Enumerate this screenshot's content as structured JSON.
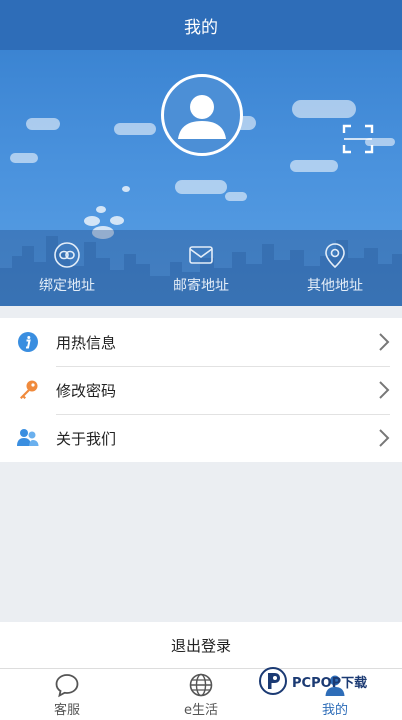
{
  "header": {
    "title": "我的"
  },
  "profile": {
    "avatar_icon": "user-avatar-icon",
    "scan_icon": "scan-icon"
  },
  "address_links": [
    {
      "label": "绑定地址",
      "icon": "link-icon"
    },
    {
      "label": "邮寄地址",
      "icon": "mail-icon"
    },
    {
      "label": "其他地址",
      "icon": "location-pin-icon"
    }
  ],
  "menu": [
    {
      "label": "用热信息",
      "icon": "info-icon",
      "icon_color": "#3a8ee0"
    },
    {
      "label": "修改密码",
      "icon": "key-icon",
      "icon_color": "#f08a3c"
    },
    {
      "label": "关于我们",
      "icon": "people-icon",
      "icon_color": "#3a8ee0"
    }
  ],
  "logout_label": "退出登录",
  "tabs": [
    {
      "label": "客服",
      "icon": "chat-bubble-icon",
      "active": false
    },
    {
      "label": "e生活",
      "icon": "globe-icon",
      "active": false
    },
    {
      "label": "我的",
      "icon": "user-icon",
      "active": true
    }
  ],
  "watermark": {
    "text": "PCPOP下载"
  },
  "colors": {
    "primary": "#2e6db8",
    "hero": "#4a92dd",
    "background": "#ebeef2"
  }
}
